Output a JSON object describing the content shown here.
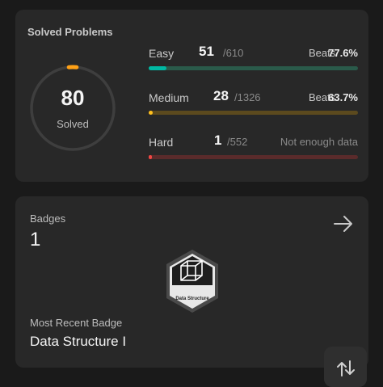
{
  "solved": {
    "title": "Solved Problems",
    "count": "80",
    "count_label": "Solved",
    "ring_fraction": 0.03,
    "colors": {
      "easy": "#00b8a3",
      "medium": "#ffc01e",
      "hard": "#ef4743"
    },
    "difficulties": [
      {
        "name": "Easy",
        "count": "51",
        "total": "/610",
        "beats_label": "Beats",
        "beats_value": "77.6%",
        "fraction": 0.084
      },
      {
        "name": "Medium",
        "count": "28",
        "total": "/1326",
        "beats_label": "Beats",
        "beats_value": "63.7%",
        "fraction": 0.021
      },
      {
        "name": "Hard",
        "count": "1",
        "total": "/552",
        "note": "Not enough data",
        "fraction": 0.002
      }
    ]
  },
  "badges": {
    "label": "Badges",
    "count": "1",
    "arrow_icon": "arrow-right-icon",
    "badge_image_text": "Data Structure",
    "recent_label": "Most Recent Badge",
    "recent_name": "Data Structure I"
  },
  "floating": {
    "icon": "swap-arrows-icon"
  }
}
